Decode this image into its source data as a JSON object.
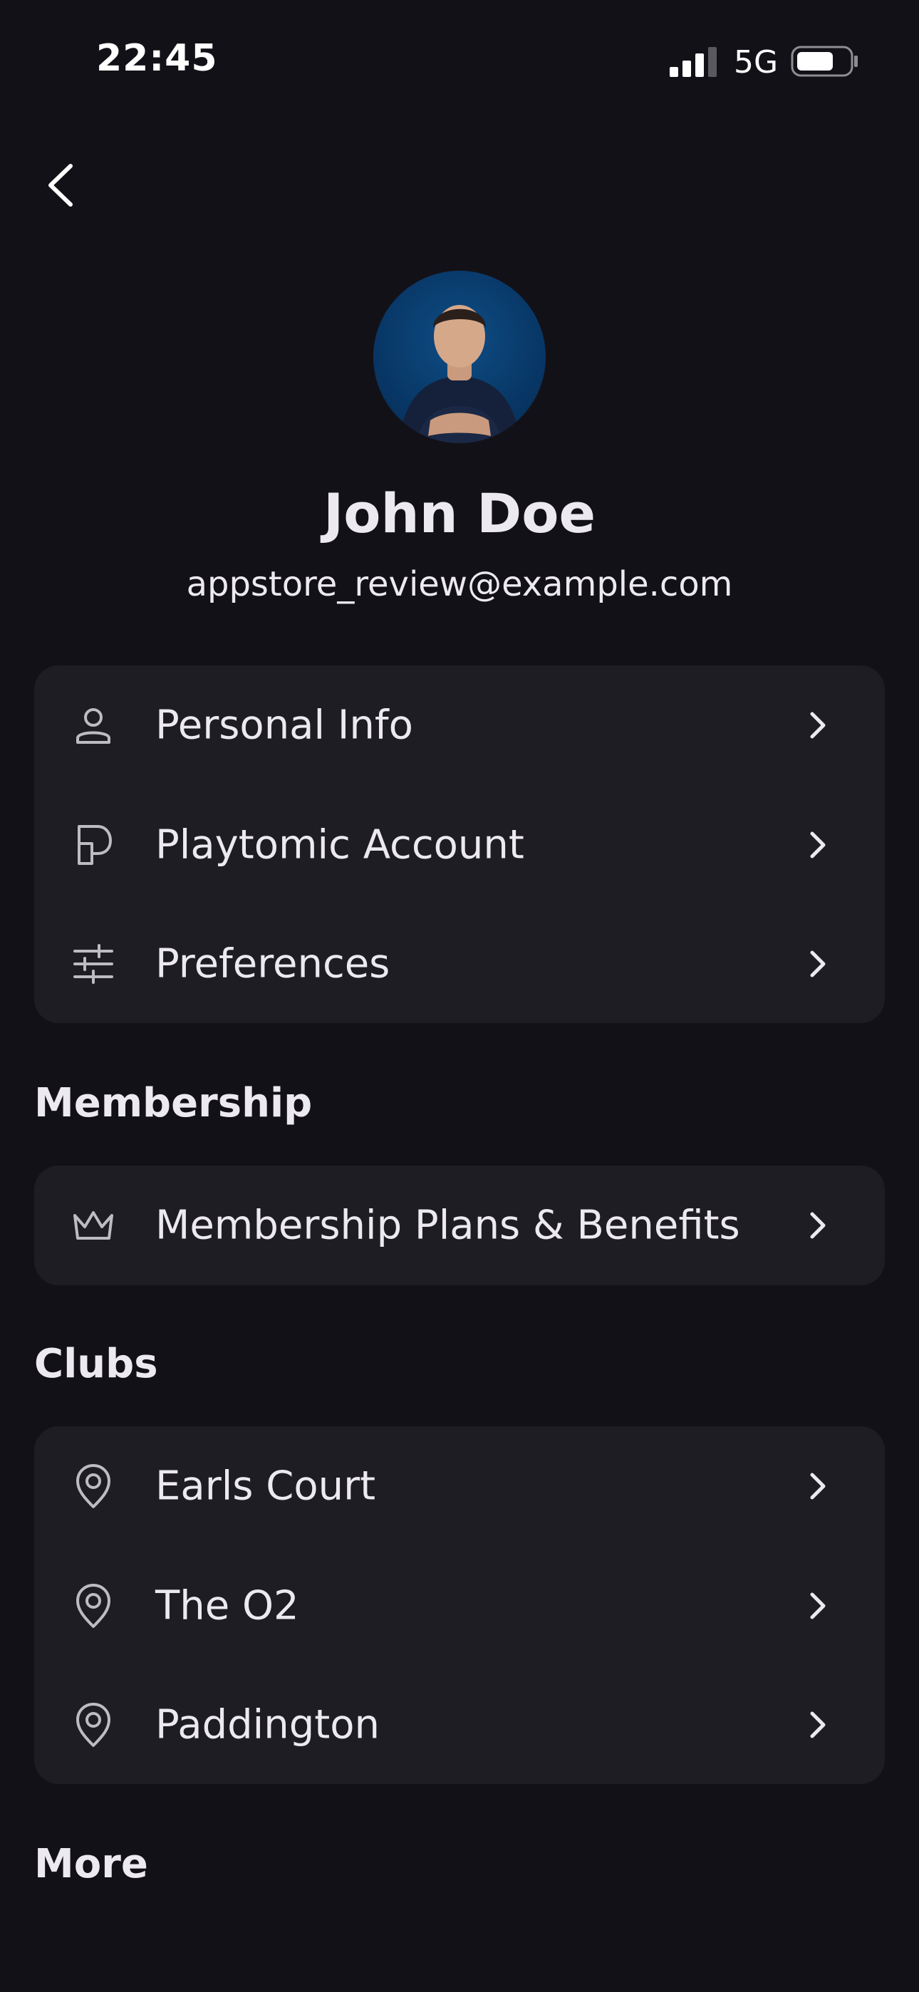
{
  "status_bar": {
    "time": "22:45",
    "network": "5G",
    "signal_icon": "signal-bars-icon",
    "battery_icon": "battery-icon"
  },
  "header": {
    "back_icon": "chevron-left-icon"
  },
  "profile": {
    "name": "John Doe",
    "email": "appstore_review@example.com"
  },
  "account_items": [
    {
      "label": "Personal Info",
      "icon": "person-icon"
    },
    {
      "label": "Playtomic Account",
      "icon": "playtomic-icon"
    },
    {
      "label": "Preferences",
      "icon": "sliders-icon"
    }
  ],
  "membership": {
    "heading": "Membership",
    "items": [
      {
        "label": "Membership Plans & Benefits",
        "icon": "crown-icon"
      }
    ]
  },
  "clubs": {
    "heading": "Clubs",
    "items": [
      {
        "label": "Earls Court",
        "icon": "location-pin-icon"
      },
      {
        "label": "The O2",
        "icon": "location-pin-icon"
      },
      {
        "label": "Paddington",
        "icon": "location-pin-icon"
      }
    ]
  },
  "more": {
    "heading": "More"
  },
  "colors": {
    "background": "#131118",
    "card": "#1E1D23",
    "text": "#ECEAEF",
    "icon": "#BDBCC2"
  }
}
